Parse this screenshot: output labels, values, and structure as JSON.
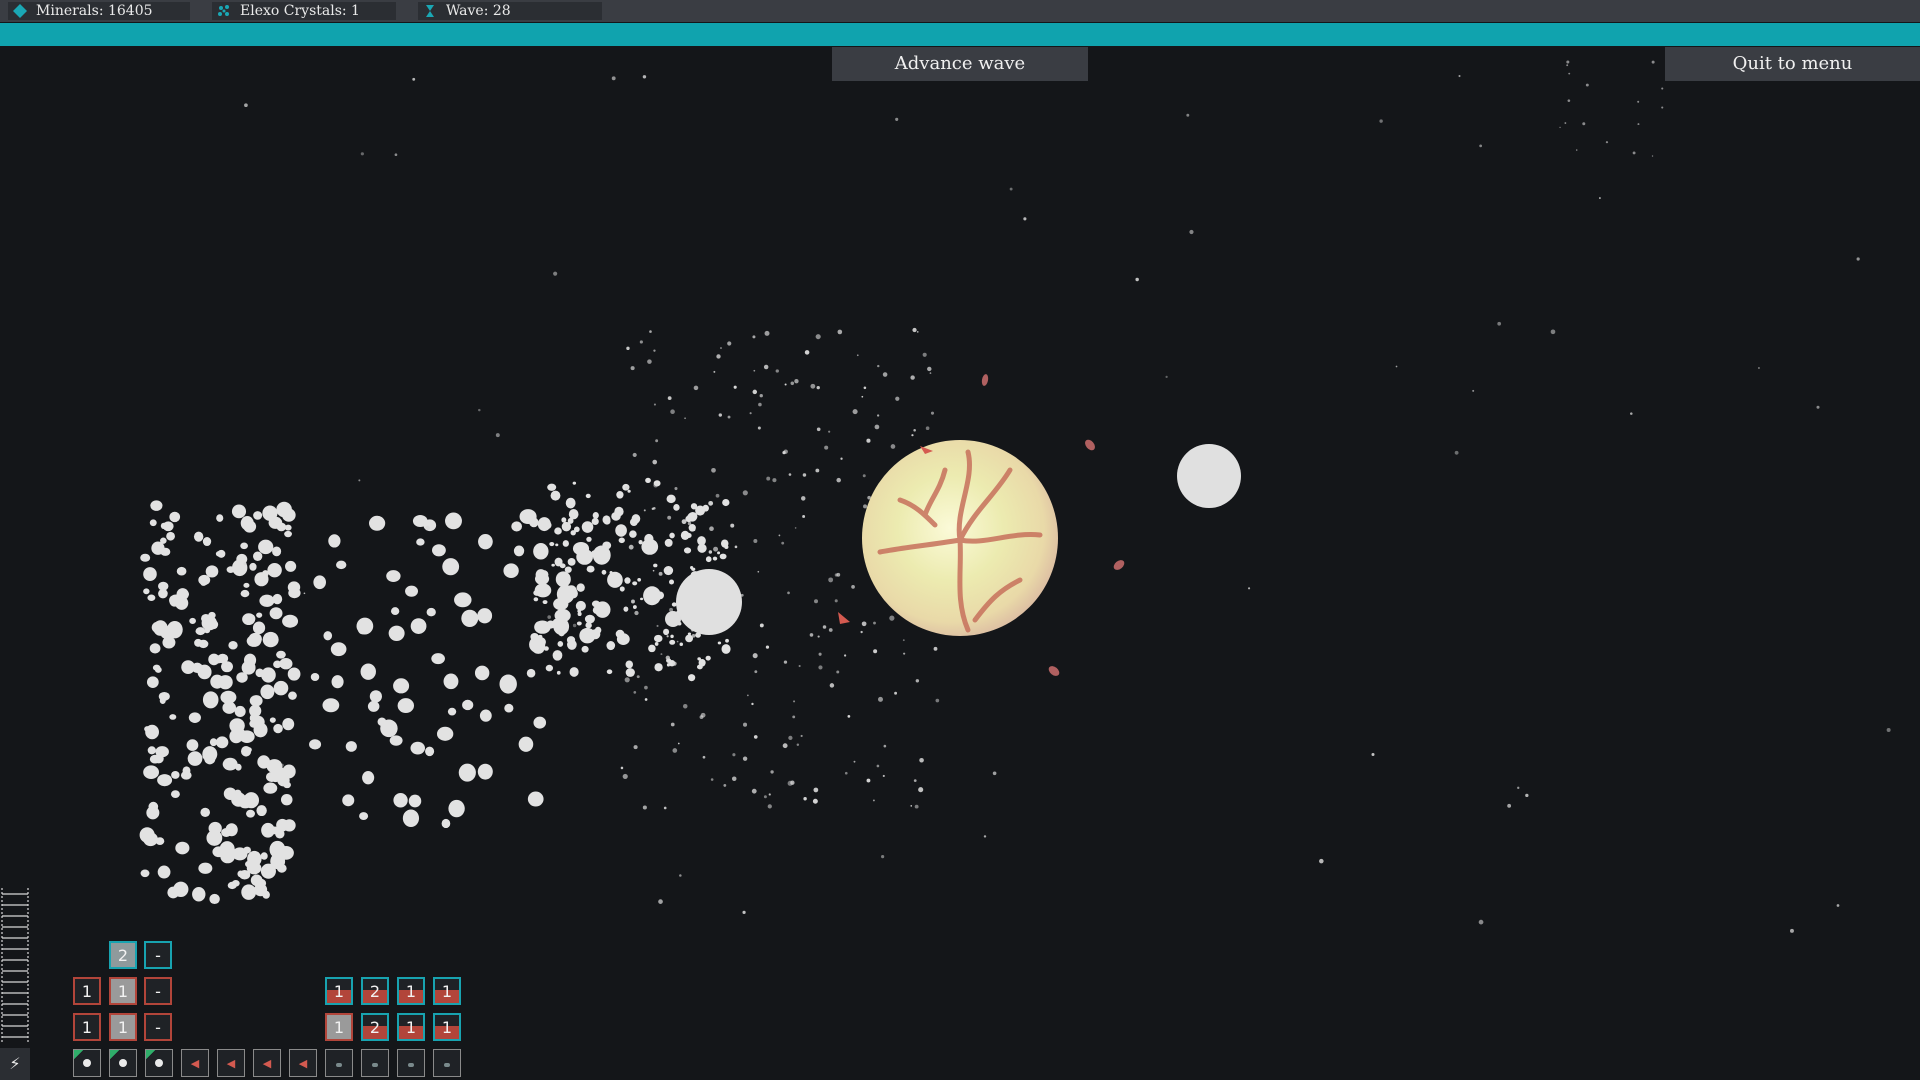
{
  "resources": {
    "minerals": "Minerals: 16405",
    "crystals": "Elexo Crystals: 1",
    "wave": "Wave: 28",
    "minerals_icon": "diamond-icon",
    "crystals_icon": "crystal-cluster-icon",
    "wave_icon": "hourglass-icon"
  },
  "buttons": {
    "advance_wave": "Advance wave",
    "quit": "Quit to menu"
  },
  "hud": {
    "left_group": [
      [
        "",
        "2",
        "-"
      ],
      [
        "1",
        "1",
        "-"
      ],
      [
        "1",
        "1",
        "-"
      ]
    ],
    "right_group": [
      [
        "1",
        "2",
        "1",
        "1"
      ],
      [
        "1",
        "2",
        "1",
        "1"
      ]
    ],
    "corner_icon": "lightning-icon"
  },
  "colors": {
    "accent": "#10a3ae",
    "background": "#141619",
    "red_outline": "#b2453a",
    "teal_outline": "#18a3b0"
  }
}
